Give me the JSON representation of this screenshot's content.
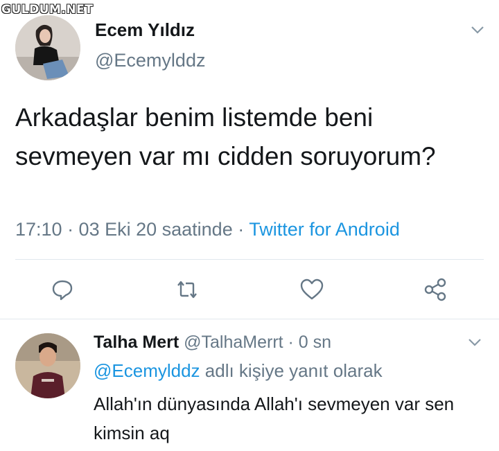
{
  "watermark": "GULDUM.NET",
  "tweet": {
    "author_name": "Ecem Yıldız",
    "author_handle": "@Ecemylddz",
    "text": "Arkadaşlar benim listemde beni sevmeyen var mı cidden soruyorum?",
    "timestamp": "17:10 · 03 Eki 20 saatinde · ",
    "source": "Twitter for Android",
    "actions": [
      "reply-icon",
      "retweet-icon",
      "like-icon",
      "share-icon"
    ]
  },
  "reply": {
    "author_name": "Talha Mert",
    "author_handle_time": "@TalhaMerrt · 0 sn",
    "replying_mention": "@Ecemylddz",
    "replying_suffix": " adlı kişiye yanıt olarak",
    "text": "Allah'ın dünyasında Allah'ı sevmeyen var sen kimsin aq"
  },
  "colors": {
    "link": "#1b95e0",
    "muted": "#657786",
    "text": "#14171a",
    "divider": "#e1e8ed"
  }
}
